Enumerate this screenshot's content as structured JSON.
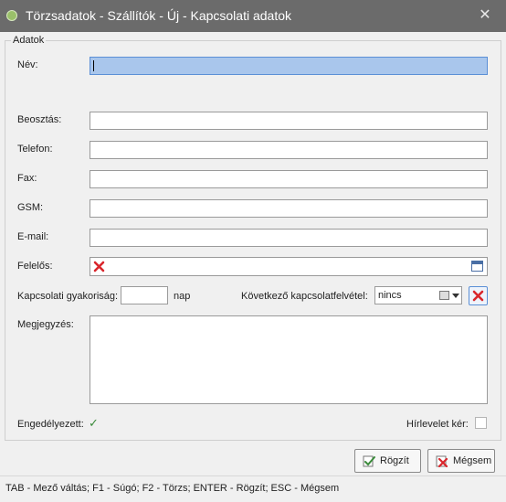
{
  "window": {
    "title": "Törzsadatok - Szállítók - Új - Kapcsolati adatok",
    "close_glyph": "✕"
  },
  "group": {
    "legend": "Adatok"
  },
  "form": {
    "name": {
      "label": "Név:",
      "value": ""
    },
    "position": {
      "label": "Beosztás:",
      "value": ""
    },
    "phone": {
      "label": "Telefon:",
      "value": ""
    },
    "fax": {
      "label": "Fax:",
      "value": ""
    },
    "gsm": {
      "label": "GSM:",
      "value": ""
    },
    "email": {
      "label": "E-mail:",
      "value": ""
    },
    "responsible": {
      "label": "Felelős:",
      "value": ""
    },
    "contact_frequency": {
      "label": "Kapcsolati gyakoriság:",
      "value": "",
      "unit": "nap"
    },
    "next_contact": {
      "label": "Következő kapcsolatfelvétel:",
      "value": "nincs"
    },
    "notes": {
      "label": "Megjegyzés:",
      "value": ""
    },
    "enabled": {
      "label": "Engedélyezett:",
      "checked": true,
      "check_glyph": "✓"
    },
    "newsletter": {
      "label": "Hírlevelet kér:",
      "checked": false
    }
  },
  "buttons": {
    "save": "Rögzít",
    "cancel": "Mégsem"
  },
  "status": {
    "text": "TAB - Mező váltás; F1 - Súgó; F2 - Törzs; ENTER - Rögzít; ESC - Mégsem"
  },
  "colors": {
    "titlebar": "#6b6b6b",
    "focus_field": "#a9c6ec",
    "clear_icon": "#d9262c",
    "check": "#3a8a3a"
  },
  "icons": {
    "app": "app-icon",
    "close": "close-icon",
    "clear": "clear-x-icon",
    "calendar": "calendar-icon",
    "save": "save-check-icon",
    "cancel": "cancel-x-icon"
  }
}
